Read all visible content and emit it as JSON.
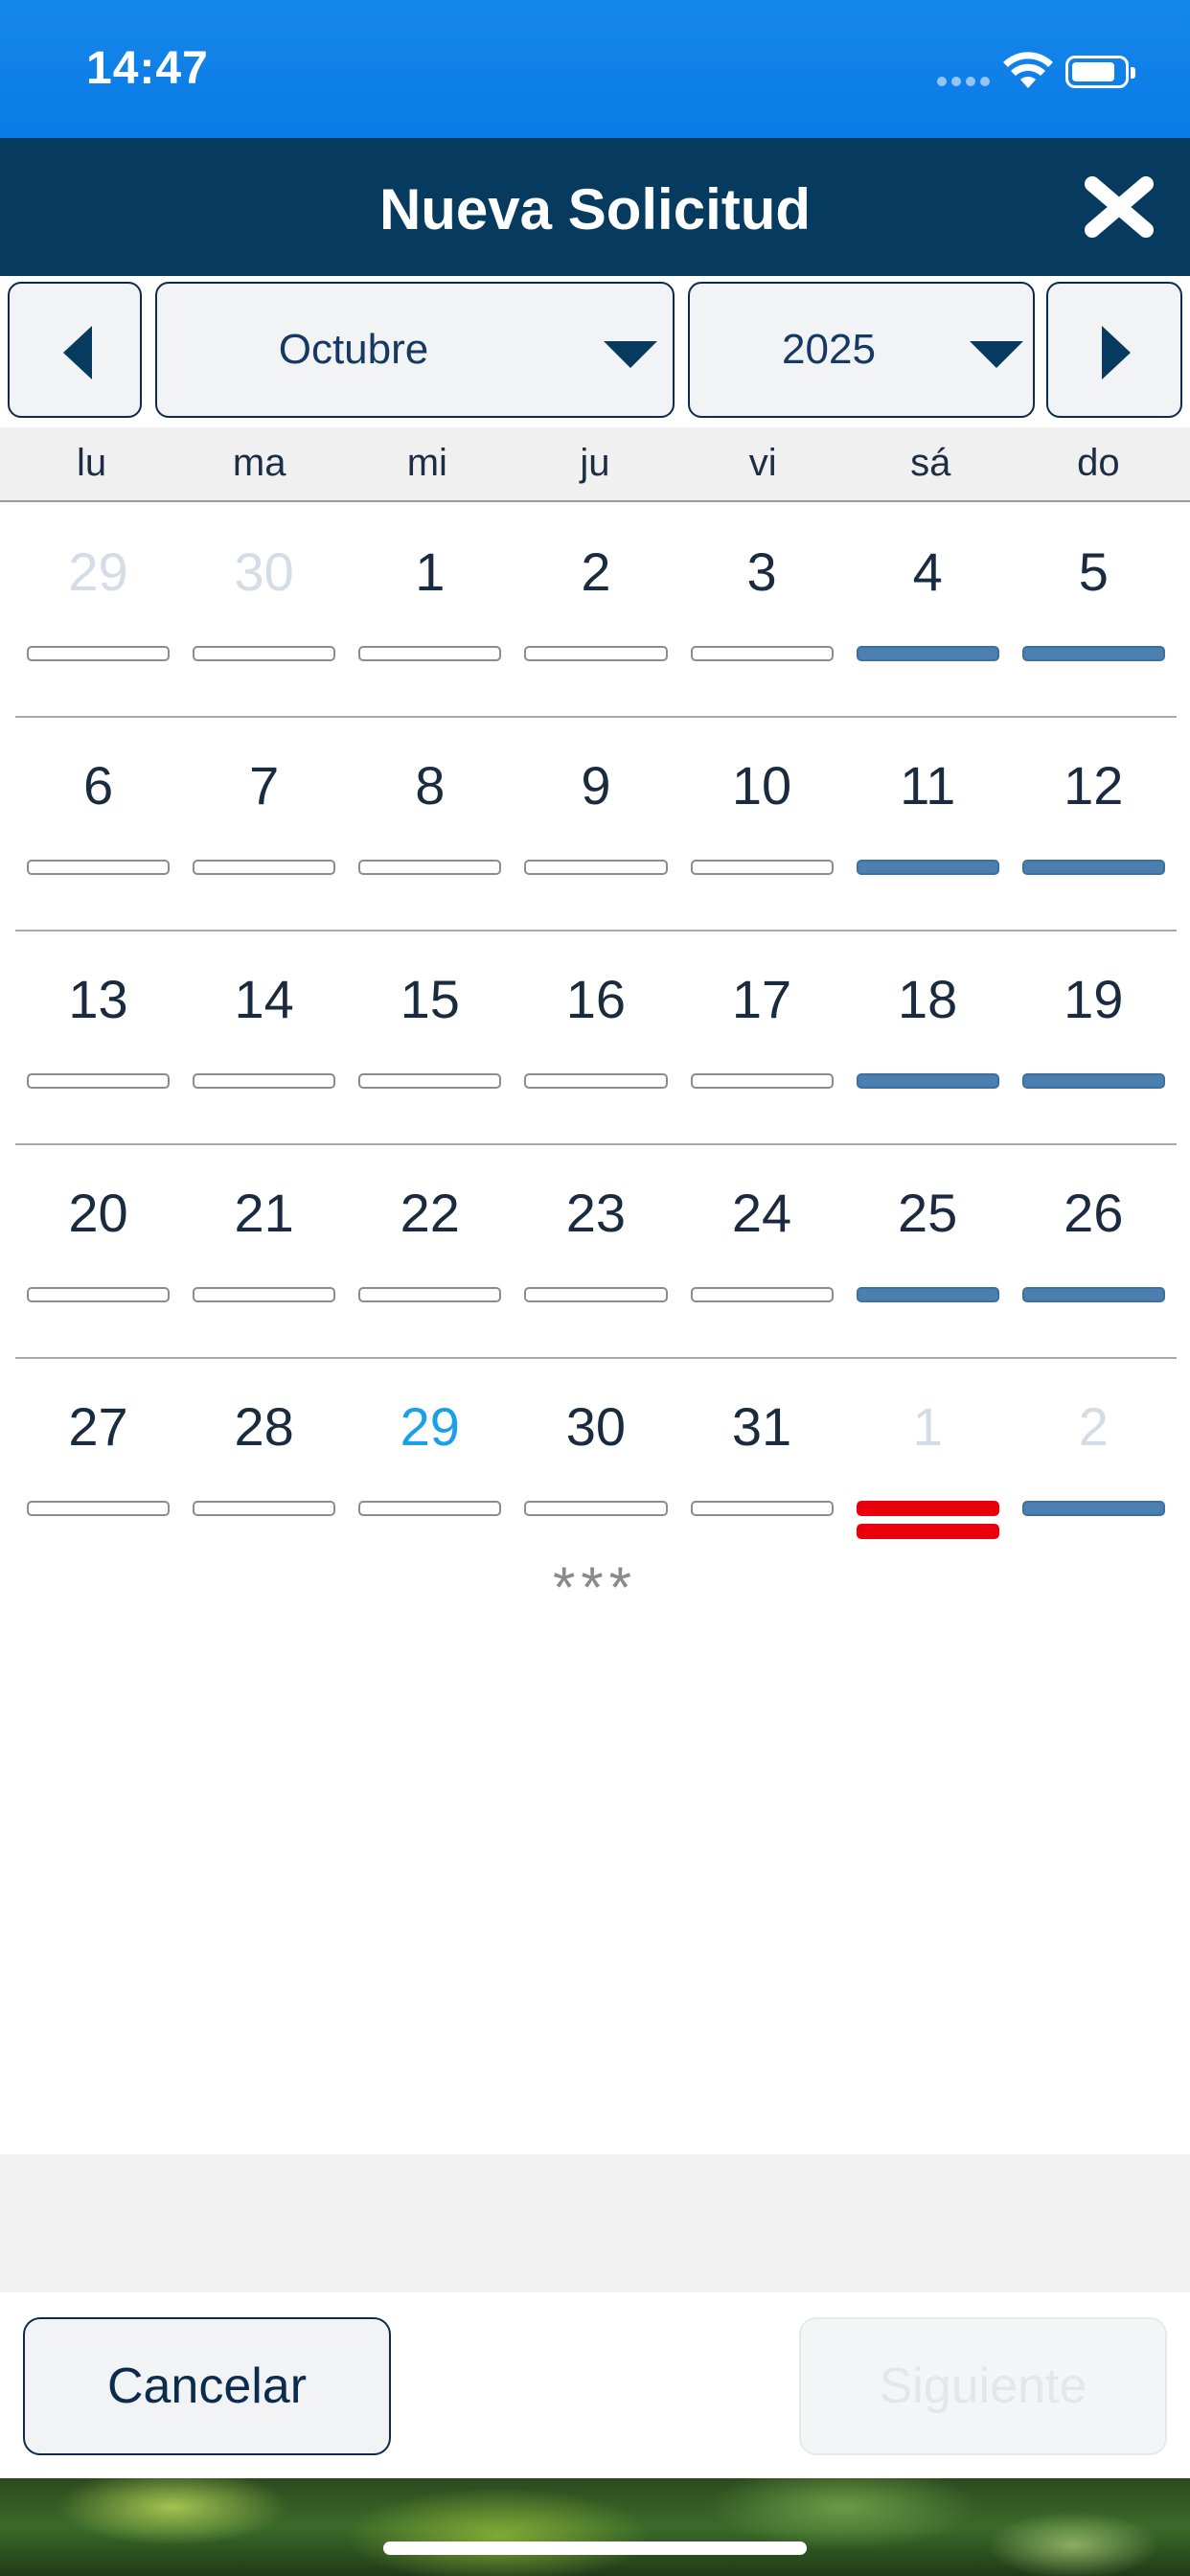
{
  "status_bar": {
    "time": "14:47"
  },
  "header": {
    "title": "Nueva Solicitud"
  },
  "selector": {
    "month": "Octubre",
    "year": "2025"
  },
  "weekdays": [
    "lu",
    "ma",
    "mi",
    "ju",
    "vi",
    "sá",
    "do"
  ],
  "weeks": [
    [
      {
        "day": "29",
        "state": "dim",
        "bar": "empty"
      },
      {
        "day": "30",
        "state": "dim",
        "bar": "empty"
      },
      {
        "day": "1",
        "state": "normal",
        "bar": "empty"
      },
      {
        "day": "2",
        "state": "normal",
        "bar": "empty"
      },
      {
        "day": "3",
        "state": "normal",
        "bar": "empty"
      },
      {
        "day": "4",
        "state": "normal",
        "bar": "blue"
      },
      {
        "day": "5",
        "state": "normal",
        "bar": "blue"
      }
    ],
    [
      {
        "day": "6",
        "state": "normal",
        "bar": "empty"
      },
      {
        "day": "7",
        "state": "normal",
        "bar": "empty"
      },
      {
        "day": "8",
        "state": "normal",
        "bar": "empty"
      },
      {
        "day": "9",
        "state": "normal",
        "bar": "empty"
      },
      {
        "day": "10",
        "state": "normal",
        "bar": "empty"
      },
      {
        "day": "11",
        "state": "normal",
        "bar": "blue"
      },
      {
        "day": "12",
        "state": "normal",
        "bar": "blue"
      }
    ],
    [
      {
        "day": "13",
        "state": "normal",
        "bar": "empty"
      },
      {
        "day": "14",
        "state": "normal",
        "bar": "empty"
      },
      {
        "day": "15",
        "state": "normal",
        "bar": "empty"
      },
      {
        "day": "16",
        "state": "normal",
        "bar": "empty"
      },
      {
        "day": "17",
        "state": "normal",
        "bar": "empty"
      },
      {
        "day": "18",
        "state": "normal",
        "bar": "blue"
      },
      {
        "day": "19",
        "state": "normal",
        "bar": "blue"
      }
    ],
    [
      {
        "day": "20",
        "state": "normal",
        "bar": "empty"
      },
      {
        "day": "21",
        "state": "normal",
        "bar": "empty"
      },
      {
        "day": "22",
        "state": "normal",
        "bar": "empty"
      },
      {
        "day": "23",
        "state": "normal",
        "bar": "empty"
      },
      {
        "day": "24",
        "state": "normal",
        "bar": "empty"
      },
      {
        "day": "25",
        "state": "normal",
        "bar": "blue"
      },
      {
        "day": "26",
        "state": "normal",
        "bar": "blue"
      }
    ],
    [
      {
        "day": "27",
        "state": "normal",
        "bar": "empty"
      },
      {
        "day": "28",
        "state": "normal",
        "bar": "empty"
      },
      {
        "day": "29",
        "state": "today",
        "bar": "empty"
      },
      {
        "day": "30",
        "state": "normal",
        "bar": "empty"
      },
      {
        "day": "31",
        "state": "normal",
        "bar": "empty"
      },
      {
        "day": "1",
        "state": "dim",
        "bar": "red-double"
      },
      {
        "day": "2",
        "state": "dim",
        "bar": "blue"
      }
    ]
  ],
  "more_indicator": "***",
  "footer": {
    "cancel_label": "Cancelar",
    "next_label": "Siguiente"
  },
  "colors": {
    "status_bar": "#0a7ae6",
    "header": "#063a5f",
    "today": "#1aa0e8",
    "weekend_bar": "#4a7faf",
    "holiday_bar": "#e8000d"
  },
  "icons": {
    "close": "close-icon",
    "prev": "chevron-left-icon",
    "next": "chevron-right-icon",
    "dropdown": "caret-down-icon"
  }
}
